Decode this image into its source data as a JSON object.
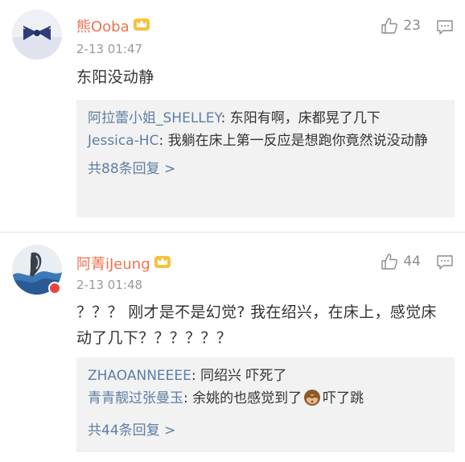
{
  "comments": [
    {
      "username": "熊Ooba",
      "time": "2-13 01:47",
      "likes": "23",
      "text": "东阳没动静",
      "replies": [
        {
          "name": "阿拉蕾小姐_SHELLEY",
          "sep": ": ",
          "text": "东阳有啊，床都晃了几下"
        },
        {
          "name": "Jessica-HC",
          "sep": ": ",
          "text": "我躺在床上第一反应是想跑你竟然说没动静"
        }
      ],
      "more": "共88条回复 >"
    },
    {
      "username": "阿菁iJeung",
      "time": "2-13 01:48",
      "likes": "44",
      "text": "？？？ 刚才是不是幻觉? 我在绍兴，在床上，感觉床动了几下？？？？？？",
      "replies": [
        {
          "name": "ZHAOANNEEEE",
          "sep": ": ",
          "text": "同绍兴 吓死了"
        },
        {
          "name": "青青靓过张曼玉",
          "sep": ": ",
          "text_before": "余姚的也感觉到了",
          "emoji": "see-no-evil-monkey",
          "text_after": "吓了跳"
        }
      ],
      "more": "共44条回复 >"
    }
  ],
  "icons": {
    "like": "thumbs-up-icon",
    "reply": "comment-icon",
    "member": "crown-icon",
    "verified": "verified-badge-icon"
  },
  "colors": {
    "username": "#eb7350",
    "link": "#5e7ea6",
    "meta": "#999999",
    "reply_bg": "#f2f2f2"
  }
}
